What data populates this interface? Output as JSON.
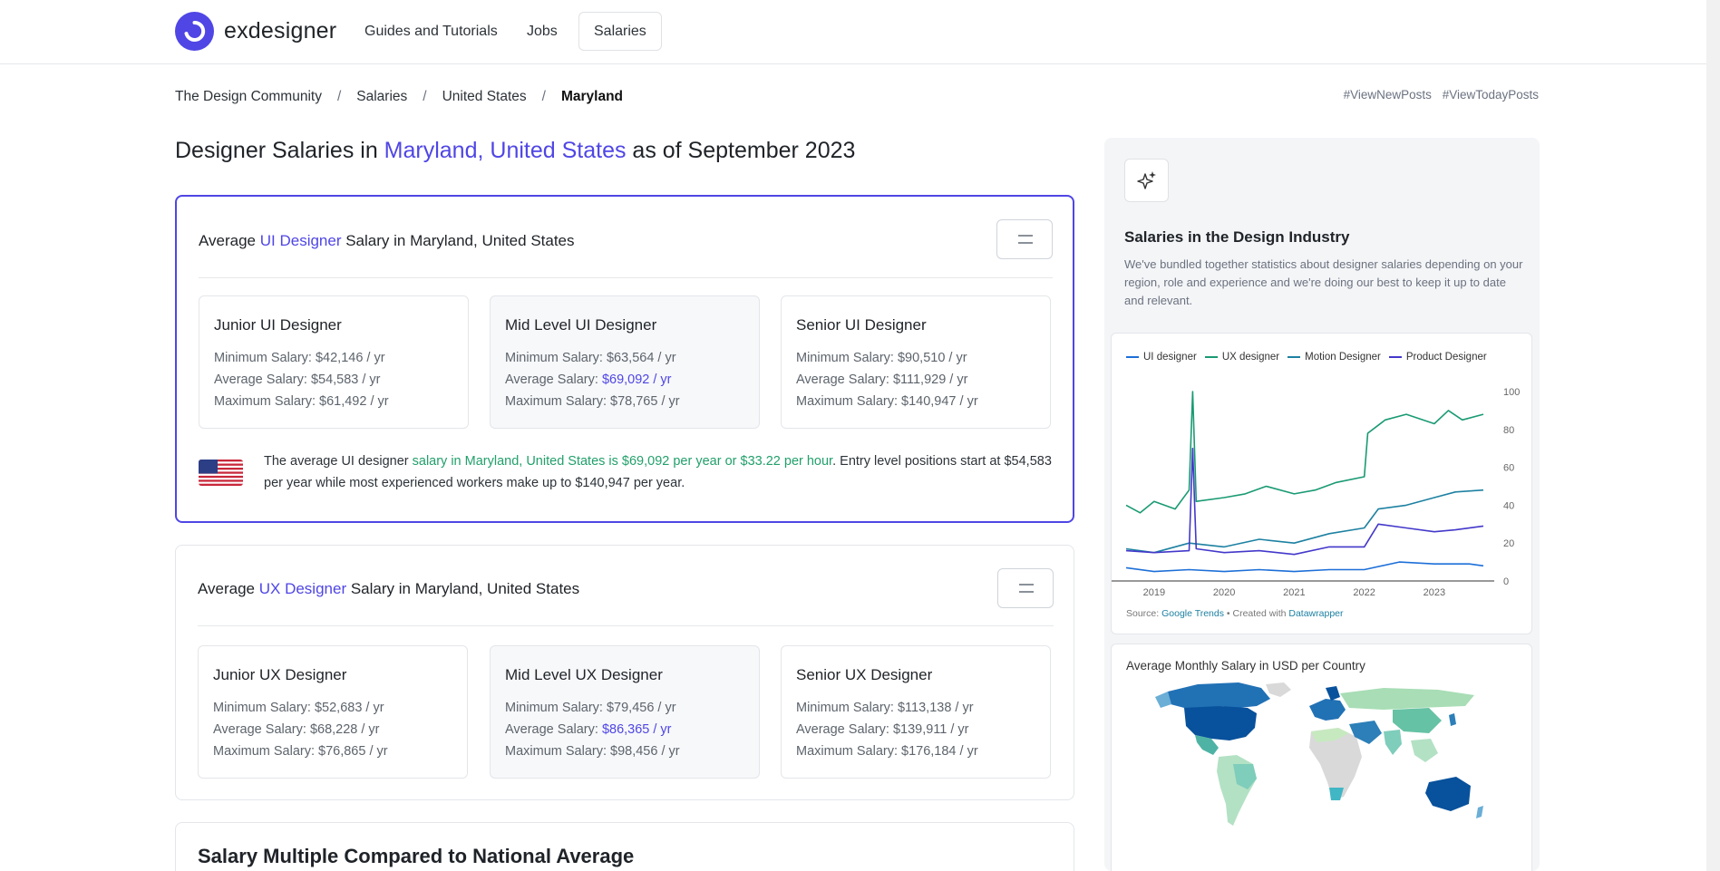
{
  "nav": {
    "brand": "exdesigner",
    "items": [
      {
        "label": "Guides and Tutorials"
      },
      {
        "label": "Jobs"
      },
      {
        "label": "Salaries"
      }
    ]
  },
  "breadcrumb": [
    "The Design Community",
    "Salaries",
    "United States",
    "Maryland"
  ],
  "tags": [
    "#ViewNewPosts",
    "#ViewTodayPosts"
  ],
  "page": {
    "title_pre": "Designer Salaries in ",
    "title_loc": "Maryland, United States",
    "title_post": " as of September 2023"
  },
  "ui_block": {
    "head_pre": "Average ",
    "head_role": "UI Designer",
    "head_post": " Salary in Maryland, United States",
    "cards": [
      {
        "title": "Junior UI Designer",
        "min": "Minimum Salary: $42,146 / yr",
        "avg_label": "Average Salary: ",
        "avg": "$54,583 / yr",
        "max": "Maximum Salary: $61,492 / yr"
      },
      {
        "title": "Mid Level UI Designer",
        "min": "Minimum Salary: $63,564 / yr",
        "avg_label": "Average Salary: ",
        "avg": "$69,092 / yr",
        "max": "Maximum Salary: $78,765 / yr"
      },
      {
        "title": "Senior UI Designer",
        "min": "Minimum Salary: $90,510 / yr",
        "avg_label": "Average Salary: ",
        "avg": "$111,929 / yr",
        "max": "Maximum Salary: $140,947 / yr"
      }
    ],
    "summary_a": "The average UI designer ",
    "summary_green": "salary in Maryland, United States is $69,092 per year or $33.22 per hour",
    "summary_b": ". Entry level positions start at $54,583 per year while most experienced workers make up to $140,947 per year."
  },
  "ux_block": {
    "head_pre": "Average ",
    "head_role": "UX Designer",
    "head_post": " Salary in Maryland, United States",
    "cards": [
      {
        "title": "Junior UX Designer",
        "min": "Minimum Salary: $52,683 / yr",
        "avg_label": "Average Salary: ",
        "avg": "$68,228 / yr",
        "max": "Maximum Salary: $76,865 / yr"
      },
      {
        "title": "Mid Level UX Designer",
        "min": "Minimum Salary: $79,456 / yr",
        "avg_label": "Average Salary: ",
        "avg": "$86,365 / yr",
        "max": "Maximum Salary: $98,456 / yr"
      },
      {
        "title": "Senior UX Designer",
        "min": "Minimum Salary: $113,138 / yr",
        "avg_label": "Average Salary: ",
        "avg": "$139,911 / yr",
        "max": "Maximum Salary: $176,184 / yr"
      }
    ]
  },
  "multiple_block": {
    "title": "Salary Multiple Compared to National Average"
  },
  "aside": {
    "title": "Salaries in the Design Industry",
    "desc": "We've bundled together statistics about designer salaries depending on your region, role and experience and we're doing our best to keep it up to date and relevant.",
    "source_label": "Source: ",
    "source_link": "Google Trends",
    "created_label": " • Created with ",
    "created_link": "Datawrapper",
    "map_title": "Average Monthly Salary in USD per Country"
  },
  "colors": {
    "accent": "#4f46e5",
    "green": "#22a06b",
    "ui": "#1d6fd8",
    "ux": "#1a9a73",
    "motion": "#1d81a2",
    "product": "#4338ca"
  },
  "chart_data": {
    "type": "line",
    "x_ticks": [
      "2019",
      "2020",
      "2021",
      "2022",
      "2023"
    ],
    "y_ticks": [
      0,
      20,
      40,
      60,
      80,
      100
    ],
    "ylim": [
      0,
      100
    ],
    "xlim": [
      2018.6,
      2023.7
    ],
    "legend_placement": "top-left",
    "series": [
      {
        "name": "UI designer",
        "color": "#1d6fd8",
        "x": [
          2018.6,
          2019.0,
          2019.5,
          2020.0,
          2020.5,
          2021.0,
          2021.5,
          2022.0,
          2022.5,
          2023.0,
          2023.5,
          2023.7
        ],
        "values": [
          7,
          5,
          6,
          5,
          6,
          5,
          6,
          6,
          10,
          9,
          9,
          8
        ]
      },
      {
        "name": "UX designer",
        "color": "#1a9a73",
        "x": [
          2018.6,
          2018.8,
          2019.0,
          2019.3,
          2019.5,
          2019.55,
          2019.6,
          2020.0,
          2020.3,
          2020.6,
          2021.0,
          2021.3,
          2021.6,
          2022.0,
          2022.05,
          2022.3,
          2022.6,
          2023.0,
          2023.2,
          2023.4,
          2023.7
        ],
        "values": [
          40,
          36,
          42,
          38,
          48,
          100,
          42,
          44,
          46,
          50,
          46,
          48,
          52,
          55,
          78,
          85,
          88,
          83,
          90,
          85,
          88
        ]
      },
      {
        "name": "Motion Designer",
        "color": "#1d81a2",
        "x": [
          2018.6,
          2019.0,
          2019.5,
          2020.0,
          2020.5,
          2021.0,
          2021.5,
          2022.0,
          2022.2,
          2022.6,
          2023.0,
          2023.3,
          2023.7
        ],
        "values": [
          17,
          15,
          20,
          18,
          22,
          20,
          25,
          28,
          38,
          40,
          44,
          47,
          48
        ]
      },
      {
        "name": "Product Designer",
        "color": "#4338ca",
        "x": [
          2018.6,
          2019.0,
          2019.5,
          2019.55,
          2019.6,
          2020.0,
          2020.5,
          2021.0,
          2021.5,
          2022.0,
          2022.2,
          2022.6,
          2023.0,
          2023.3,
          2023.7
        ],
        "values": [
          16,
          15,
          16,
          70,
          17,
          15,
          16,
          14,
          18,
          18,
          30,
          28,
          26,
          27,
          29
        ]
      }
    ]
  }
}
